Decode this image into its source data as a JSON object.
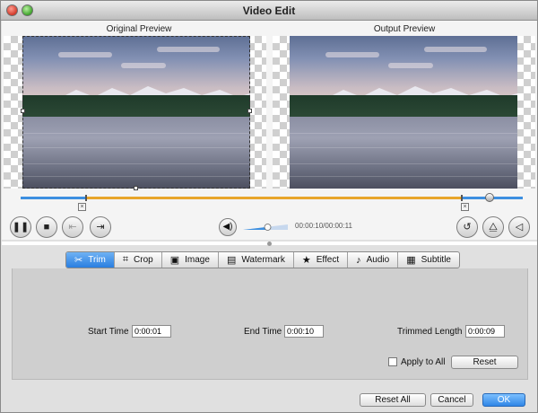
{
  "window": {
    "title": "Video Edit"
  },
  "preview": {
    "original_label": "Original Preview",
    "output_label": "Output Preview"
  },
  "playback": {
    "time_readout": "00:00:10/00:00:11",
    "volume_level": 0.55
  },
  "tabs": [
    {
      "label": "Trim",
      "icon": "scissors-icon",
      "active": true
    },
    {
      "label": "Crop",
      "icon": "crop-icon",
      "active": false
    },
    {
      "label": "Image",
      "icon": "image-icon",
      "active": false
    },
    {
      "label": "Watermark",
      "icon": "watermark-icon",
      "active": false
    },
    {
      "label": "Effect",
      "icon": "star-icon",
      "active": false
    },
    {
      "label": "Audio",
      "icon": "music-note-icon",
      "active": false
    },
    {
      "label": "Subtitle",
      "icon": "subtitle-icon",
      "active": false
    }
  ],
  "trim": {
    "start_label": "Start Time",
    "start_value": "0:00:01",
    "end_label": "End Time",
    "end_value": "0:00:10",
    "length_label": "Trimmed Length",
    "length_value": "0:00:09",
    "apply_all_label": "Apply to All",
    "reset_label": "Reset"
  },
  "footer": {
    "reset_all_label": "Reset All",
    "cancel_label": "Cancel",
    "ok_label": "OK"
  },
  "colors": {
    "accent": "#2f86e6",
    "trim_range": "#e8a52a",
    "timeline": "#3d8fe0"
  }
}
